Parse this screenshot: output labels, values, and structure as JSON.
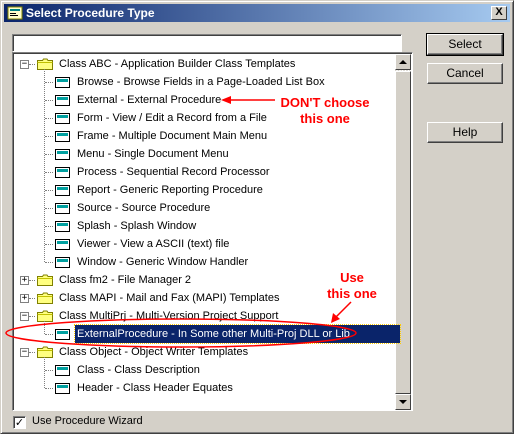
{
  "window": {
    "title": "Select Procedure Type",
    "close_label": "X"
  },
  "search": {
    "value": ""
  },
  "tree": {
    "groups": [
      {
        "label": "Class ABC - Application Builder Class Templates",
        "expanded": true,
        "items": [
          "Browse - Browse Fields in a Page-Loaded List Box",
          "External - External Procedure",
          "Form - View / Edit a Record from a File",
          "Frame - Multiple Document Main Menu",
          "Menu - Single Document Menu",
          "Process - Sequential Record Processor",
          "Report - Generic Reporting Procedure",
          "Source - Source Procedure",
          "Splash - Splash Window",
          "Viewer - View a ASCII (text) file",
          "Window - Generic Window Handler"
        ]
      },
      {
        "label": "Class fm2 - File Manager 2",
        "expanded": false,
        "items": []
      },
      {
        "label": "Class MAPI - Mail and Fax (MAPI) Templates",
        "expanded": false,
        "items": []
      },
      {
        "label": "Class MultiPrj - Multi-Version Project Support",
        "expanded": true,
        "items": [
          "ExternalProcedure - In Some other Multi-Proj DLL or Lib"
        ]
      },
      {
        "label": "Class Object - Object Writer Templates",
        "expanded": true,
        "items": [
          "Class - Class Description",
          "Header - Class Header Equates"
        ]
      }
    ],
    "selected_item": "ExternalProcedure - In Some other Multi-Proj DLL or Lib"
  },
  "buttons": {
    "select": "Select",
    "cancel": "Cancel",
    "help": "Help"
  },
  "wizard_checkbox": {
    "label": "Use Procedure Wizard",
    "checked": true,
    "check_glyph": "✓"
  },
  "annotations": {
    "dont_line1": "DON'T choose",
    "dont_line2": "this one",
    "use_line1": "Use",
    "use_line2": "this one",
    "color": "#ff0000"
  },
  "colors": {
    "titlebar_start": "#0a246a",
    "titlebar_end": "#a6caf0",
    "selection": "#0a246a",
    "dialog_bg": "#d4d0c8"
  }
}
